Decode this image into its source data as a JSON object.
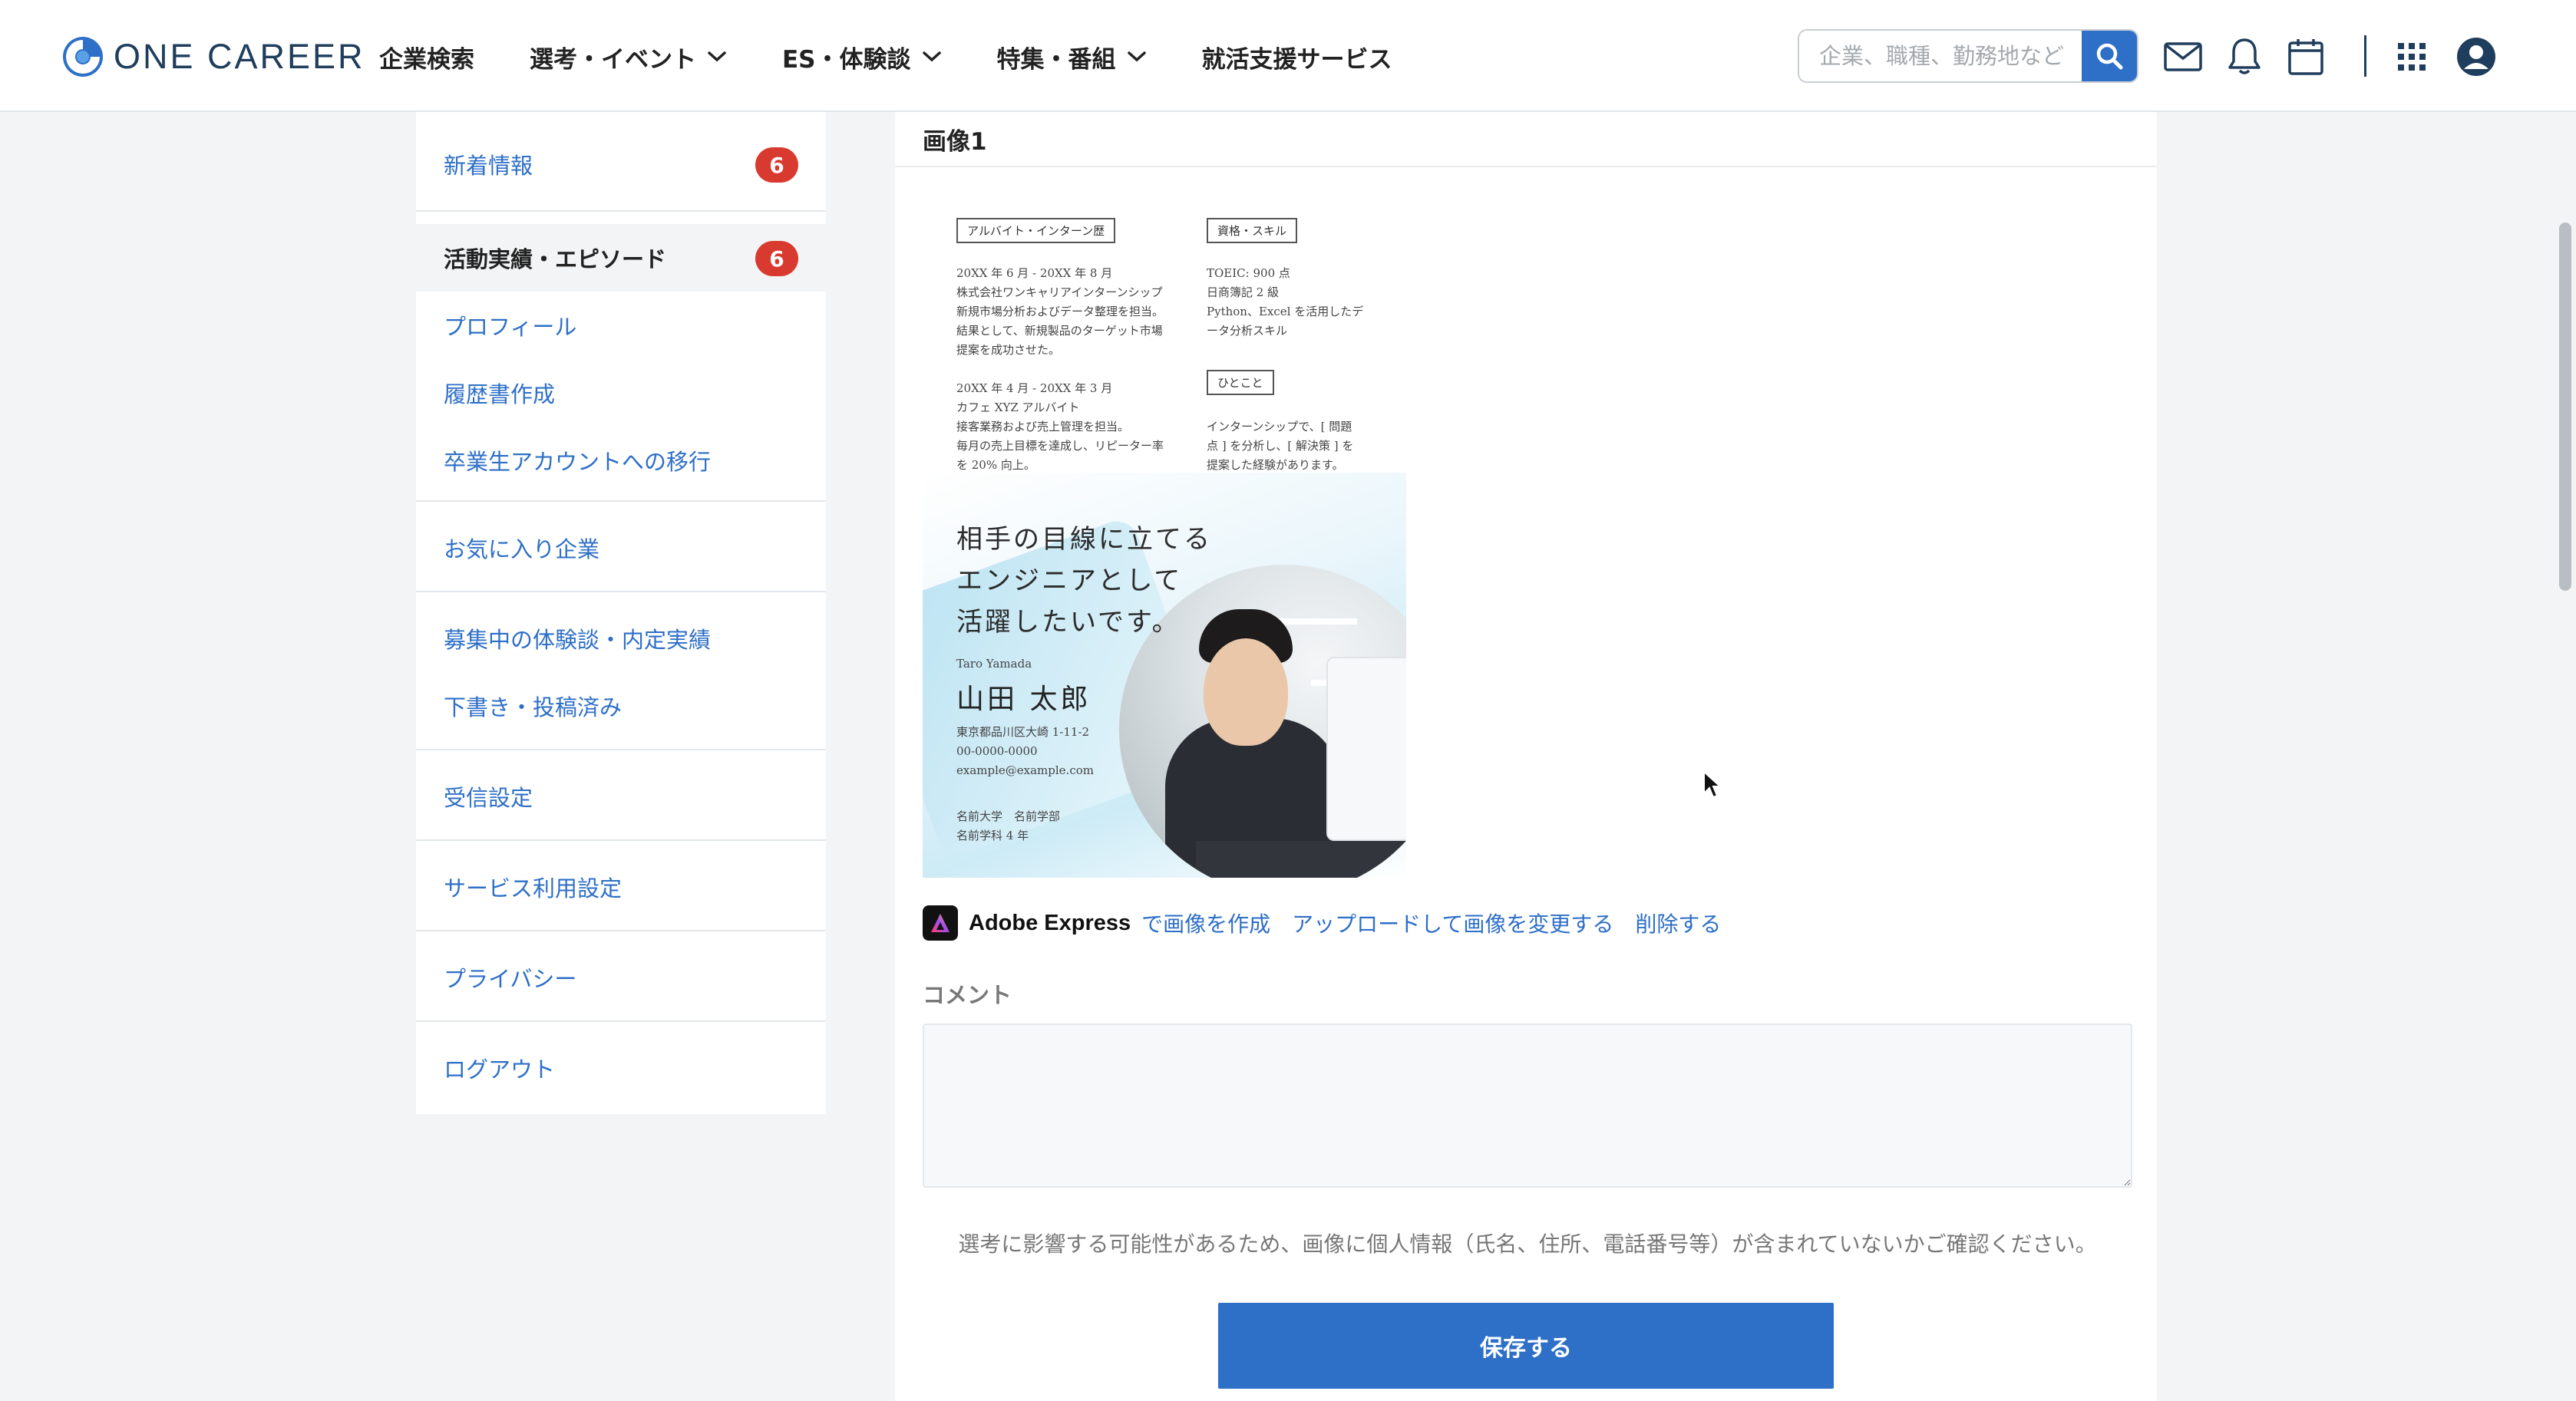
{
  "header": {
    "logo_text": "ONE CAREER",
    "nav": [
      {
        "label": "企業検索",
        "dropdown": false
      },
      {
        "label": "選考・イベント",
        "dropdown": true
      },
      {
        "label": "ES・体験談",
        "dropdown": true
      },
      {
        "label": "特集・番組",
        "dropdown": true
      },
      {
        "label": "就活支援サービス",
        "dropdown": false
      }
    ],
    "search_placeholder": "企業、職種、勤務地など",
    "icons": [
      "search-icon",
      "mail-icon",
      "bell-icon",
      "calendar-icon",
      "apps-grid-icon",
      "account-icon"
    ]
  },
  "sidebar": {
    "groups": [
      [
        {
          "label": "新着情報",
          "badge": "6",
          "active": false
        }
      ],
      [
        {
          "label": "活動実績・エピソード",
          "badge": "6",
          "active": true
        },
        {
          "label": "プロフィール",
          "badge": "",
          "active": false
        },
        {
          "label": "履歴書作成",
          "badge": "",
          "active": false
        },
        {
          "label": "卒業生アカウントへの移行",
          "badge": "",
          "active": false
        }
      ],
      [
        {
          "label": "お気に入り企業",
          "badge": "",
          "active": false
        }
      ],
      [
        {
          "label": "募集中の体験談・内定実績",
          "badge": "",
          "active": false
        },
        {
          "label": "下書き・投稿済み",
          "badge": "",
          "active": false
        }
      ],
      [
        {
          "label": "受信設定",
          "badge": "",
          "active": false
        }
      ],
      [
        {
          "label": "サービス利用設定",
          "badge": "",
          "active": false
        }
      ],
      [
        {
          "label": "プライバシー",
          "badge": "",
          "active": false
        }
      ],
      [
        {
          "label": "ログアウト",
          "badge": "",
          "active": false
        }
      ]
    ]
  },
  "main": {
    "section_title": "画像1",
    "resume": {
      "box_part_time": "アルバイト・インターン歴",
      "box_skills": "資格・スキル",
      "box_hitokoto": "ひとこと",
      "part_time_text_1": "20XX 年 6 月 - 20XX 年 8 月\n株式会社ワンキャリアインターンシップ\n新規市場分析およびデータ整理を担当。\n結果として、新規製品のターゲット市場\n提案を成功させた。",
      "part_time_text_2": "20XX 年 4 月 - 20XX 年 3 月\nカフェ XYZ アルバイト\n接客業務および売上管理を担当。\n毎月の売上目標を達成し、リピーター率\nを 20% 向上。",
      "skills_text": "TOEIC: 900 点\n日商簿記 2 級\nPython、Excel を活用したデ\nータ分析スキル",
      "hitokoto_text": "インターンシップで、[ 問題\n点 ] を分析し、[ 解決策 ] を\n提案した経験があります。",
      "headline": "相手の目線に立てる\nエンジニアとして\n活躍したいです。",
      "name_en": "Taro Yamada",
      "name": "山田 太郎",
      "contact": "東京都品川区大崎 1-11-2\n00-0000-0000\nexample@example.com",
      "school": "名前大学　名前学部\n名前学科 4 年"
    },
    "adobe_label": "Adobe Express",
    "link_create": "で画像を作成",
    "link_upload": "アップロードして画像を変更する",
    "link_delete": "削除する",
    "comment_label": "コメント",
    "comment_value": "",
    "notice": "選考に影響する可能性があるため、画像に個人情報（氏名、住所、電話番号等）が含まれていないかご確認ください。",
    "save_label": "保存する"
  }
}
